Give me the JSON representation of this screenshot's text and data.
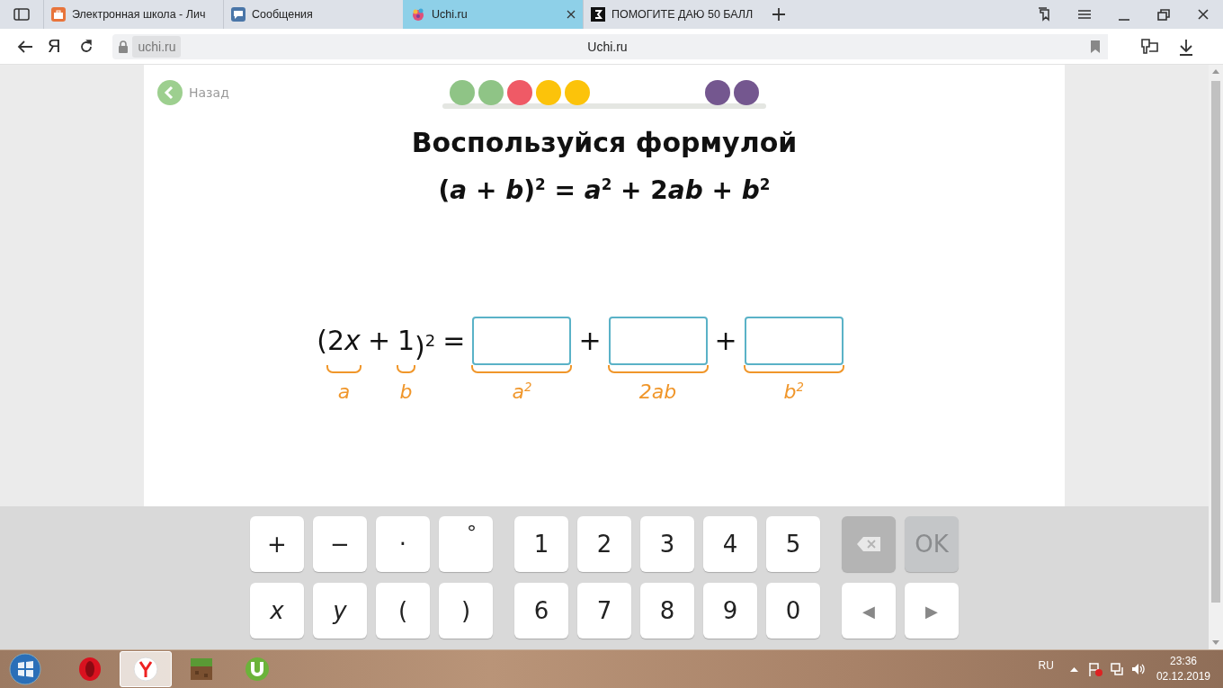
{
  "tabs": [
    {
      "title": "Электронная школа - Лич",
      "kind": "briefcase",
      "selected": false
    },
    {
      "title": "Сообщения",
      "kind": "chat",
      "selected": false
    },
    {
      "title": "Uchi.ru",
      "kind": "palette",
      "selected": true
    },
    {
      "title": "ПОМОГИТЕ ДАЮ 50 БАЛЛ",
      "kind": "square",
      "selected": false
    }
  ],
  "toolbar": {
    "logo": "Я"
  },
  "address": {
    "url": "uchi.ru",
    "page_title": "Uchi.ru"
  },
  "lesson": {
    "back": "Назад",
    "dot_groups": [
      {
        "dots": [
          {
            "color": "#8fc486"
          },
          {
            "color": "#8fc486"
          },
          {
            "color": "#ef5a66"
          },
          {
            "color": "#fcc30a"
          },
          {
            "color": "#fcc30a"
          }
        ]
      },
      {
        "dots": [
          {
            "color": "#74578f"
          },
          {
            "color": "#74578f"
          }
        ]
      }
    ],
    "title": "Воспользуйся формулой",
    "formula": [
      "(*a* + *b*)$^{2}$ = *a*$^{2}$ + 2",
      "*ab* + *b*$^{2}$"
    ],
    "equation": [
      {
        "kind": "text",
        "text": [
          "("
        ]
      },
      {
        "kind": "braced",
        "text": [
          "2",
          "*x*"
        ],
        "label": "a"
      },
      {
        "kind": "op",
        "text": [
          "+"
        ]
      },
      {
        "kind": "braced",
        "text": [
          "1"
        ],
        "label": "b"
      },
      {
        "kind": "text",
        "text": [
          ")$^{2}$"
        ]
      },
      {
        "kind": "op",
        "text": [
          "="
        ]
      },
      {
        "kind": "box",
        "label": "a$^{2}$"
      },
      {
        "kind": "op",
        "text": [
          "+"
        ]
      },
      {
        "kind": "box",
        "label": "2ab"
      },
      {
        "kind": "op",
        "text": [
          "+"
        ]
      },
      {
        "kind": "box",
        "label": "b$^{2}$"
      }
    ]
  },
  "keyboard": {
    "rows": [
      {
        "groups": [
          [
            {
              "kind": "key",
              "label": "+",
              "disabled": false
            },
            {
              "kind": "key",
              "label": "−",
              "disabled": false
            },
            {
              "kind": "key",
              "label": "·",
              "disabled": false
            },
            {
              "kind": "degree",
              "label": "°",
              "disabled": false
            }
          ],
          [
            {
              "kind": "key",
              "label": "1",
              "disabled": false
            },
            {
              "kind": "key",
              "label": "2",
              "disabled": false
            },
            {
              "kind": "key",
              "label": "3",
              "disabled": false
            },
            {
              "kind": "key",
              "label": "4",
              "disabled": false
            },
            {
              "kind": "key",
              "label": "5",
              "disabled": false
            }
          ],
          [
            {
              "kind": "backspace",
              "disabled": true
            },
            {
              "kind": "ok",
              "label": "OK",
              "disabled": true
            }
          ]
        ]
      },
      {
        "groups": [
          [
            {
              "kind": "variable",
              "label": "x",
              "disabled": false
            },
            {
              "kind": "variable",
              "label": "y",
              "disabled": false
            },
            {
              "kind": "key",
              "label": "(",
              "disabled": false
            },
            {
              "kind": "key",
              "label": ")",
              "disabled": false
            }
          ],
          [
            {
              "kind": "key",
              "label": "6",
              "disabled": false
            },
            {
              "kind": "key",
              "label": "7",
              "disabled": false
            },
            {
              "kind": "key",
              "label": "8",
              "disabled": false
            },
            {
              "kind": "key",
              "label": "9",
              "disabled": false
            },
            {
              "kind": "key",
              "label": "0",
              "disabled": false
            }
          ],
          [
            {
              "kind": "arrow",
              "label": "◀",
              "disabled": false
            },
            {
              "kind": "arrow",
              "label": "▶",
              "disabled": false
            }
          ]
        ]
      }
    ]
  },
  "taskbar": {
    "apps": [
      {
        "kind": "opera",
        "selected": false
      },
      {
        "kind": "yandex",
        "selected": true
      },
      {
        "kind": "grass",
        "selected": false
      },
      {
        "kind": "torrent",
        "selected": false
      }
    ],
    "language": "RU",
    "time": "23:36",
    "date": "02.12.2019"
  }
}
